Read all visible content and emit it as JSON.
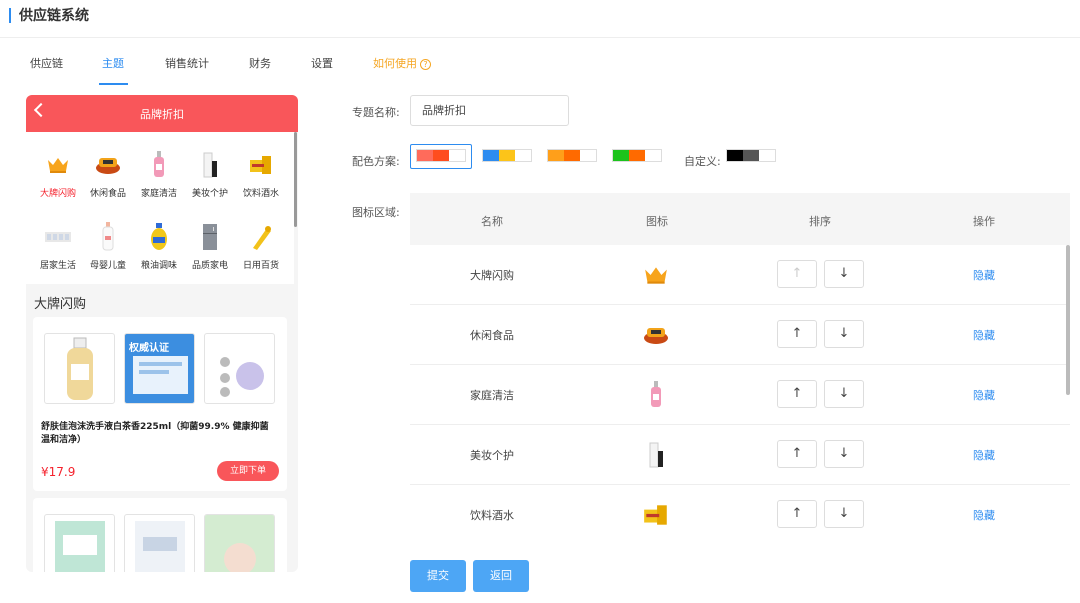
{
  "app": {
    "title": "供应链系统"
  },
  "tabs": [
    {
      "label": "供应链"
    },
    {
      "label": "主题"
    },
    {
      "label": "销售统计"
    },
    {
      "label": "财务"
    },
    {
      "label": "设置"
    },
    {
      "label": "如何使用"
    }
  ],
  "help_icon_glyph": "?",
  "preview": {
    "title": "品牌折扣",
    "categories": [
      {
        "label": "大牌闪购",
        "icon": "crown-icon"
      },
      {
        "label": "休闲食品",
        "icon": "snack-icon"
      },
      {
        "label": "家庭清洁",
        "icon": "cleaner-bottle-icon"
      },
      {
        "label": "美妆个护",
        "icon": "cosmetic-tube-icon"
      },
      {
        "label": "饮料酒水",
        "icon": "drink-box-icon"
      },
      {
        "label": "居家生活",
        "icon": "home-goods-icon"
      },
      {
        "label": "母婴儿童",
        "icon": "baby-bottle-icon"
      },
      {
        "label": "粮油调味",
        "icon": "oil-bottle-icon"
      },
      {
        "label": "品质家电",
        "icon": "fridge-icon"
      },
      {
        "label": "日用百货",
        "icon": "daily-goods-icon"
      }
    ],
    "section_title": "大牌闪购",
    "product": {
      "name": "舒肤佳泡沫洗手液白茶香225ml（抑菌99.9% 健康抑菌温和洁净）",
      "price": "¥17.9",
      "buy_label": "立即下单",
      "thumb_badge": "权威认证"
    }
  },
  "form": {
    "name_label": "专题名称:",
    "name_value": "品牌折扣",
    "color_label": "配色方案:",
    "custom_label": "自定义:",
    "icon_area_label": "图标区域:",
    "color_schemes": [
      [
        "#ff6b5b",
        "#ff4d1f"
      ],
      [
        "#2d8cf0",
        "#fcc419"
      ],
      [
        "#ff9f1a",
        "#ff6a00"
      ],
      [
        "#1cc31c",
        "#ff6a00"
      ]
    ],
    "custom_colors": [
      "#000000",
      "#555555"
    ]
  },
  "table": {
    "headers": {
      "name": "名称",
      "icon": "图标",
      "sort": "排序",
      "action": "操作"
    },
    "up_glyph": "↑",
    "down_glyph": "↓",
    "rows": [
      {
        "name": "大牌闪购",
        "icon": "crown-icon",
        "action": "隐藏"
      },
      {
        "name": "休闲食品",
        "icon": "snack-icon",
        "action": "隐藏"
      },
      {
        "name": "家庭清洁",
        "icon": "cleaner-bottle-icon",
        "action": "隐藏"
      },
      {
        "name": "美妆个护",
        "icon": "cosmetic-tube-icon",
        "action": "隐藏"
      },
      {
        "name": "饮料酒水",
        "icon": "drink-box-icon",
        "action": "隐藏"
      }
    ]
  },
  "actions": {
    "submit_label": "提交",
    "back_label": "返回"
  }
}
